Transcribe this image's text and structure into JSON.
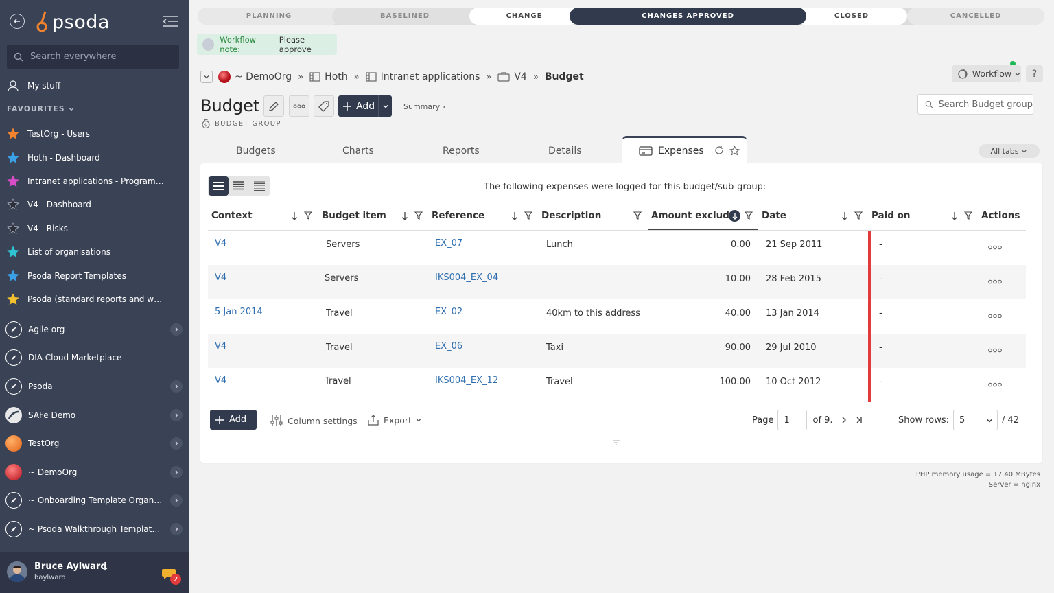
{
  "app": {
    "name": "psoda",
    "brand_color": "#f2832f",
    "sidebar_bg": "#3a4255"
  },
  "sidebar": {
    "search_placeholder": "Search everywhere",
    "my_stuff": "My stuff",
    "favourites_label": "FAVOURITES",
    "favourites": [
      {
        "label": "TestOrg - Users",
        "color": "#f2832f"
      },
      {
        "label": "Hoth - Dashboard",
        "color": "#3aa0e8"
      },
      {
        "label": "Intranet applications - Programme...",
        "color": "#d84cc8"
      },
      {
        "label": "V4 - Dashboard",
        "color": "#2b2f3a"
      },
      {
        "label": "V4 - Risks",
        "color": "#2b2f3a"
      },
      {
        "label": "List of organisations",
        "color": "#2fc4d4"
      },
      {
        "label": "Psoda Report Templates",
        "color": "#3aa0e8"
      },
      {
        "label": "Psoda (standard reports and work...",
        "color": "#f2c12f"
      }
    ],
    "orgs": [
      {
        "label": "Agile org",
        "icon": "compass-icon",
        "expand": true
      },
      {
        "label": "DIA Cloud Marketplace",
        "icon": "compass-icon",
        "expand": false
      },
      {
        "label": "Psoda",
        "icon": "compass-icon",
        "expand": true
      },
      {
        "label": "SAFe Demo",
        "icon": "safe-logo-icon",
        "expand": true
      },
      {
        "label": "TestOrg",
        "icon": "orange-ball-icon",
        "expand": true
      },
      {
        "label": "~ DemoOrg",
        "icon": "red-ball-icon",
        "expand": true
      },
      {
        "label": "~ Onboarding Template Organisa...",
        "icon": "compass-icon",
        "expand": true
      },
      {
        "label": "~ Psoda Walkthrough Template P...",
        "icon": "compass-icon",
        "expand": true
      }
    ],
    "user": {
      "name": "Bruce Aylward",
      "username": "baylward",
      "notifications": "2"
    }
  },
  "workflow": {
    "stages": [
      "PLANNING",
      "BASELINED",
      "CHANGE",
      "CHANGES APPROVED",
      "CLOSED",
      "CANCELLED"
    ],
    "current": "CHANGES APPROVED",
    "note_label": "Workflow note:",
    "note_text": "Please approve",
    "button": "Workflow"
  },
  "breadcrumb": [
    "~ DemoOrg",
    "Hoth",
    "Intranet applications",
    "V4",
    "Budget"
  ],
  "page": {
    "title": "Budget",
    "type": "BUDGET GROUP",
    "add_label": "Add",
    "summary_link": "Summary ›",
    "search_placeholder": "Search Budget group",
    "help": "?"
  },
  "tabs": [
    "Budgets",
    "Charts",
    "Reports",
    "Details",
    "Expenses"
  ],
  "active_tab": "Expenses",
  "all_tabs": "All tabs",
  "table": {
    "intro": "The following expenses were logged for this budget/sub-group:",
    "columns": [
      "Context",
      "Budget item",
      "Reference",
      "Description",
      "Amount exclud...",
      "Date",
      "Paid on",
      "Actions"
    ],
    "rows": [
      {
        "context": "V4",
        "item": "Servers",
        "ref": "EX_07",
        "desc": "Lunch",
        "amount": "0.00",
        "date": "21 Sep 2011",
        "paid": "-"
      },
      {
        "context": "V4",
        "item": "Servers",
        "ref": "IKS004_EX_04",
        "desc": "",
        "amount": "10.00",
        "date": "28 Feb 2015",
        "paid": "-"
      },
      {
        "context": "5 Jan 2014",
        "item": "Travel",
        "ref": "EX_02",
        "desc": "40km to this address",
        "amount": "40.00",
        "date": "13 Jan 2014",
        "paid": "-"
      },
      {
        "context": "V4",
        "item": "Travel",
        "ref": "EX_06",
        "desc": "Taxi",
        "amount": "90.00",
        "date": "29 Jul 2010",
        "paid": "-"
      },
      {
        "context": "V4",
        "item": "Travel",
        "ref": "IKS004_EX_12",
        "desc": "Travel",
        "amount": "100.00",
        "date": "10 Oct 2012",
        "paid": "-"
      }
    ]
  },
  "footer": {
    "add": "Add",
    "column_settings": "Column settings",
    "export": "Export",
    "page_label": "Page",
    "page": "1",
    "of": "of 9.",
    "show_rows": "Show rows:",
    "rows_value": "5",
    "total": "/ 42"
  },
  "server": {
    "memory": "PHP memory usage = 17.40 MBytes",
    "server": "Server = nginx"
  }
}
